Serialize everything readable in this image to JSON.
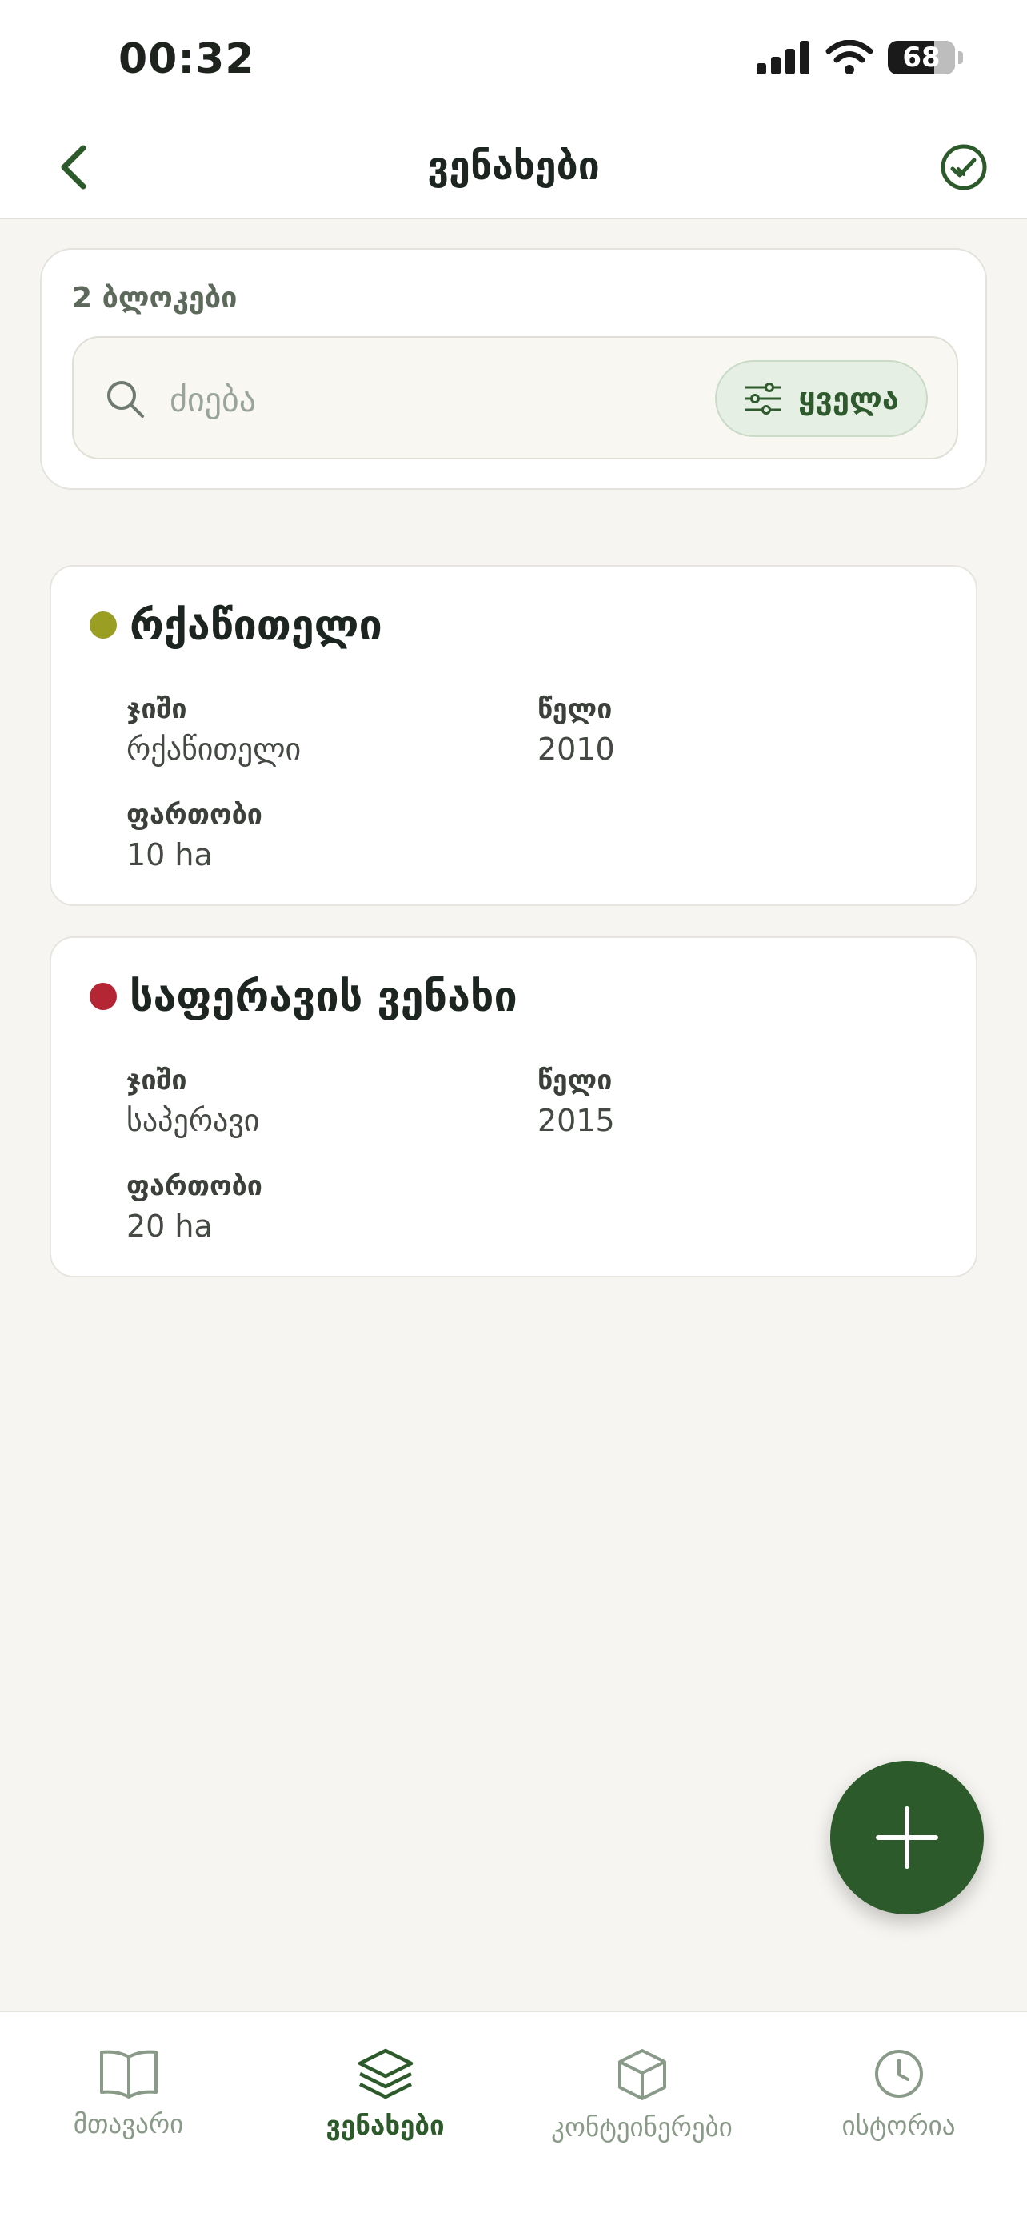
{
  "status_bar": {
    "time": "00:32",
    "battery": "68"
  },
  "nav": {
    "title": "ვენახები"
  },
  "search": {
    "count_label": "2 ბლოკები",
    "placeholder": "ძიება",
    "filter_label": "ყველა"
  },
  "vineyards": [
    {
      "name": "რქაწითელი",
      "status_color": "#9a9e22",
      "variety_label": "ჯიში",
      "variety": "რქაწითელი",
      "year_label": "წელი",
      "year": "2010",
      "area_label": "ფართობი",
      "area": "10 ha"
    },
    {
      "name": "საფერავის ვენახი",
      "status_color": "#b52634",
      "variety_label": "ჯიში",
      "variety": "საპერავი",
      "year_label": "წელი",
      "year": "2015",
      "area_label": "ფართობი",
      "area": "20 ha"
    }
  ],
  "tabs": [
    {
      "label": "მთავარი",
      "icon": "book-open-icon"
    },
    {
      "label": "ვენახები",
      "icon": "layers-icon",
      "active": true
    },
    {
      "label": "კონტეინერები",
      "icon": "box-icon"
    },
    {
      "label": "ისტორია",
      "icon": "clock-icon"
    }
  ],
  "colors": {
    "accent": "#2d5a2a",
    "background": "#f6f5f1"
  }
}
